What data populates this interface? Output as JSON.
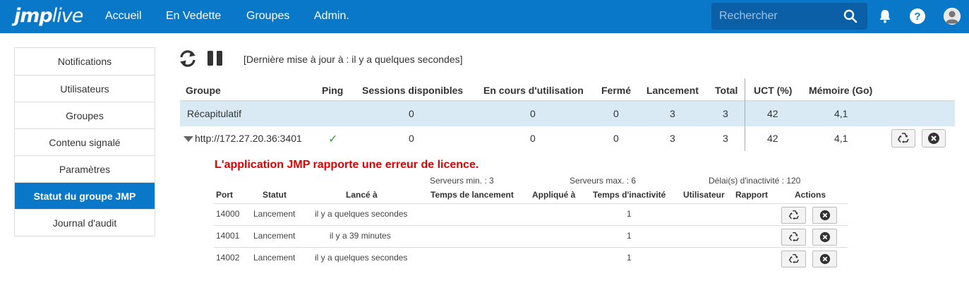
{
  "brand": {
    "logo_a": "jmp",
    "logo_b": "live"
  },
  "nav": {
    "items": [
      "Accueil",
      "En Vedette",
      "Groupes",
      "Admin."
    ]
  },
  "search": {
    "placeholder": "Rechercher"
  },
  "sidebar": {
    "items": [
      {
        "label": "Notifications"
      },
      {
        "label": "Utilisateurs"
      },
      {
        "label": "Groupes"
      },
      {
        "label": "Contenu signalé"
      },
      {
        "label": "Paramètres"
      },
      {
        "label": "Statut du groupe JMP",
        "active": true
      },
      {
        "label": "Journal d'audit"
      }
    ]
  },
  "toolbar": {
    "last_update": "[Dernière mise à jour à : il y a quelques secondes]"
  },
  "table": {
    "headers": [
      "Groupe",
      "Ping",
      "Sessions disponibles",
      "En cours d'utilisation",
      "Fermé",
      "Lancement",
      "Total",
      "UCT (%)",
      "Mémoire (Go)"
    ],
    "summary": {
      "group": "Récapitulatif",
      "sessions": "0",
      "in_use": "0",
      "closed": "0",
      "launching": "3",
      "total": "3",
      "cpu": "42",
      "memory": "4,1"
    },
    "server": {
      "group": "http://172.27.20.36:3401",
      "ping": "✓",
      "sessions": "0",
      "in_use": "0",
      "closed": "0",
      "launching": "3",
      "total": "3",
      "cpu": "42",
      "memory": "4,1"
    }
  },
  "detail": {
    "error": "L'application JMP rapporte une erreur de licence.",
    "min_servers": "Serveurs min. : 3",
    "max_servers": "Serveurs max. : 6",
    "inactivity_delay": "Délai(s) d'inactivité : 120",
    "headers": [
      "Port",
      "Statut",
      "Lancé à",
      "Temps de lancement",
      "Appliqué à",
      "Temps d'inactivité",
      "Utilisateur",
      "Rapport",
      "Actions"
    ],
    "rows": [
      {
        "port": "14000",
        "status": "Lancement",
        "launched": "il y a quelques secondes",
        "inactivity": "1"
      },
      {
        "port": "14001",
        "status": "Lancement",
        "launched": "il y a 39 minutes",
        "inactivity": "1"
      },
      {
        "port": "14002",
        "status": "Lancement",
        "launched": "il y a quelques secondes",
        "inactivity": "1"
      }
    ]
  },
  "colors": {
    "primary": "#0a78c8",
    "summary_row": "#d9eaf5",
    "error": "#e00000",
    "ping_ok": "#2eaa2e"
  },
  "icons": [
    "search-icon",
    "bell-icon",
    "help-icon",
    "avatar-icon",
    "refresh-icon",
    "pause-icon",
    "recycle-icon",
    "close-icon",
    "caret-down-icon",
    "check-icon"
  ]
}
